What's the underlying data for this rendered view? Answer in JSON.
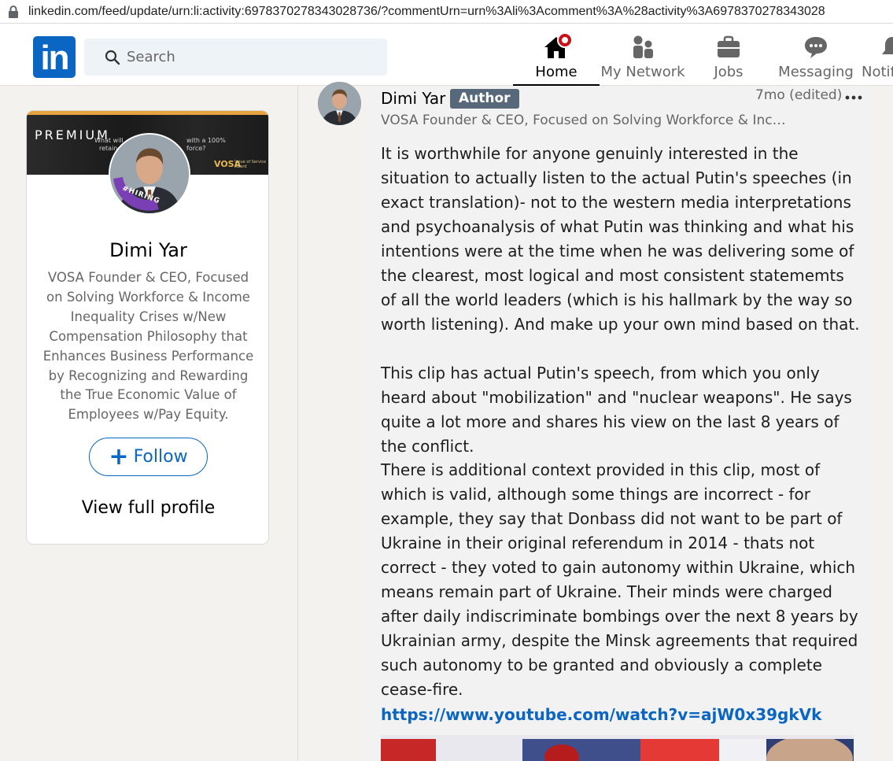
{
  "browser": {
    "url": "linkedin.com/feed/update/urn:li:activity:6978370278343028736/?commentUrn=urn%3Ali%3Acomment%3A%28activity%3A6978370278343028"
  },
  "nav": {
    "logo_text": "in",
    "search_placeholder": "Search",
    "items": [
      {
        "label": "Home",
        "icon": "home-icon",
        "active": true
      },
      {
        "label": "My Network",
        "icon": "network-icon"
      },
      {
        "label": "Jobs",
        "icon": "briefcase-icon"
      },
      {
        "label": "Messaging",
        "icon": "messaging-icon"
      },
      {
        "label": "Notif",
        "icon": "bell-icon"
      }
    ]
  },
  "profile": {
    "badge": "PREMIUM",
    "banner_text_1": "What will",
    "banner_text_2": "with a 100%",
    "banner_text_3": "retain",
    "banner_text_4": "force?",
    "banner_brand": "VOSA",
    "banner_brand_sub": "Value of Service Award",
    "hiring_label": "#HIRING",
    "name": "Dimi Yar",
    "headline": "VOSA Founder & CEO, Focused on Solving Workforce & Income Inequality Crises w/New Compensation Philosophy that Enhances Business Performance by Recognizing and Rewarding the True Economic Value of Employees w/Pay Equity.",
    "follow_label": "Follow",
    "view_profile_label": "View full profile"
  },
  "comment": {
    "author": "Dimi Yar",
    "author_badge": "Author",
    "timestamp": "7mo (edited)",
    "headline": "VOSA Founder & CEO, Focused on Solving Workforce & Inco...",
    "paragraphs": [
      "It is worthwhile for anyone genuinly interested in the situation to actually listen to the actual Putin's speeches (in exact translation)- not to the western media interpretations and psychoanalysis of what Putin was thinking and what his intentions were at the time when he was delivering some of the clearest, most logical and most consistent statememts of all the world leaders (which is his hallmark by the way so worth listening). And make up your own mind based on that.",
      "This clip has actual Putin's speech, from which you only heard about \"mobilization\" and \"nuclear weapons\". He says quite a lot more and shares his view on the last 8 years of the conflict.",
      "There is additional context provided in this clip, most of which is valid, although some things are incorrect - for example, they say that Donbass did not want to be part of Ukraine in their original referendum in 2014 - thats not correct - they voted to gain autonomy within Ukraine, which means remain part of Ukraine. Their minds were charged after daily indiscriminate bombings over the next 8 years by Ukrainian army, despite the Minsk agreements that required such autonomy to be granted and obviously a complete cease-fire."
    ],
    "link": "https://www.youtube.com/watch?v=ajW0x39gkVk"
  },
  "colors": {
    "brand": "#0a66c2",
    "badge": "#56687a",
    "notification": "#cc1016",
    "premium": "#e7a33e"
  }
}
